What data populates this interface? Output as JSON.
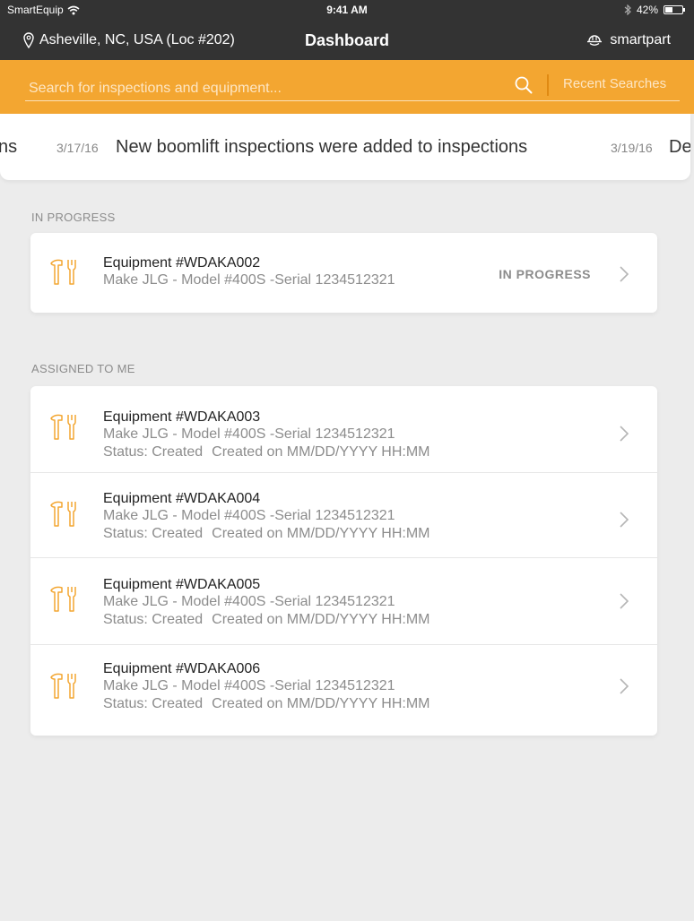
{
  "status_bar": {
    "carrier": "SmartEquip",
    "time": "9:41 AM",
    "battery_percent": "42%",
    "battery_level": 0.42
  },
  "nav": {
    "location": "Asheville, NC, USA (Loc #202)",
    "title": "Dashboard",
    "smartpart_label": "smartpart"
  },
  "search": {
    "placeholder": "Search for inspections and equipment...",
    "value": "",
    "recent_label": "Recent Searches"
  },
  "ticker": {
    "prev_text_fragment": "ns",
    "items": [
      {
        "date": "3/17/16",
        "text": "New boomlift inspections were added to inspections"
      },
      {
        "date": "3/19/16",
        "text": "De"
      }
    ]
  },
  "colors": {
    "accent": "#f3a631",
    "topbar": "#333333",
    "background": "#ececec",
    "icon": "#f3a631"
  },
  "in_progress": {
    "label": "IN PROGRESS",
    "items": [
      {
        "title": "Equipment #WDAKA002",
        "details": "Make JLG - Model #400S -Serial 1234512321",
        "badge": "IN PROGRESS",
        "icon": "tools-icon"
      }
    ]
  },
  "assigned": {
    "label": "ASSIGNED TO ME",
    "items": [
      {
        "title": "Equipment #WDAKA003",
        "details": "Make JLG - Model #400S -Serial 1234512321",
        "status": "Status: Created",
        "created": "Created on MM/DD/YYYY HH:MM",
        "icon": "tools-icon"
      },
      {
        "title": "Equipment #WDAKA004",
        "details": "Make JLG - Model #400S -Serial 1234512321",
        "status": "Status: Created",
        "created": "Created on MM/DD/YYYY HH:MM",
        "icon": "tools-icon"
      },
      {
        "title": "Equipment #WDAKA005",
        "details": "Make JLG - Model #400S -Serial 1234512321",
        "status": "Status: Created",
        "created": "Created on MM/DD/YYYY HH:MM",
        "icon": "tools-icon"
      },
      {
        "title": "Equipment #WDAKA006",
        "details": "Make JLG - Model #400S -Serial 1234512321",
        "status": "Status: Created",
        "created": "Created on MM/DD/YYYY HH:MM",
        "icon": "tools-icon"
      }
    ]
  }
}
